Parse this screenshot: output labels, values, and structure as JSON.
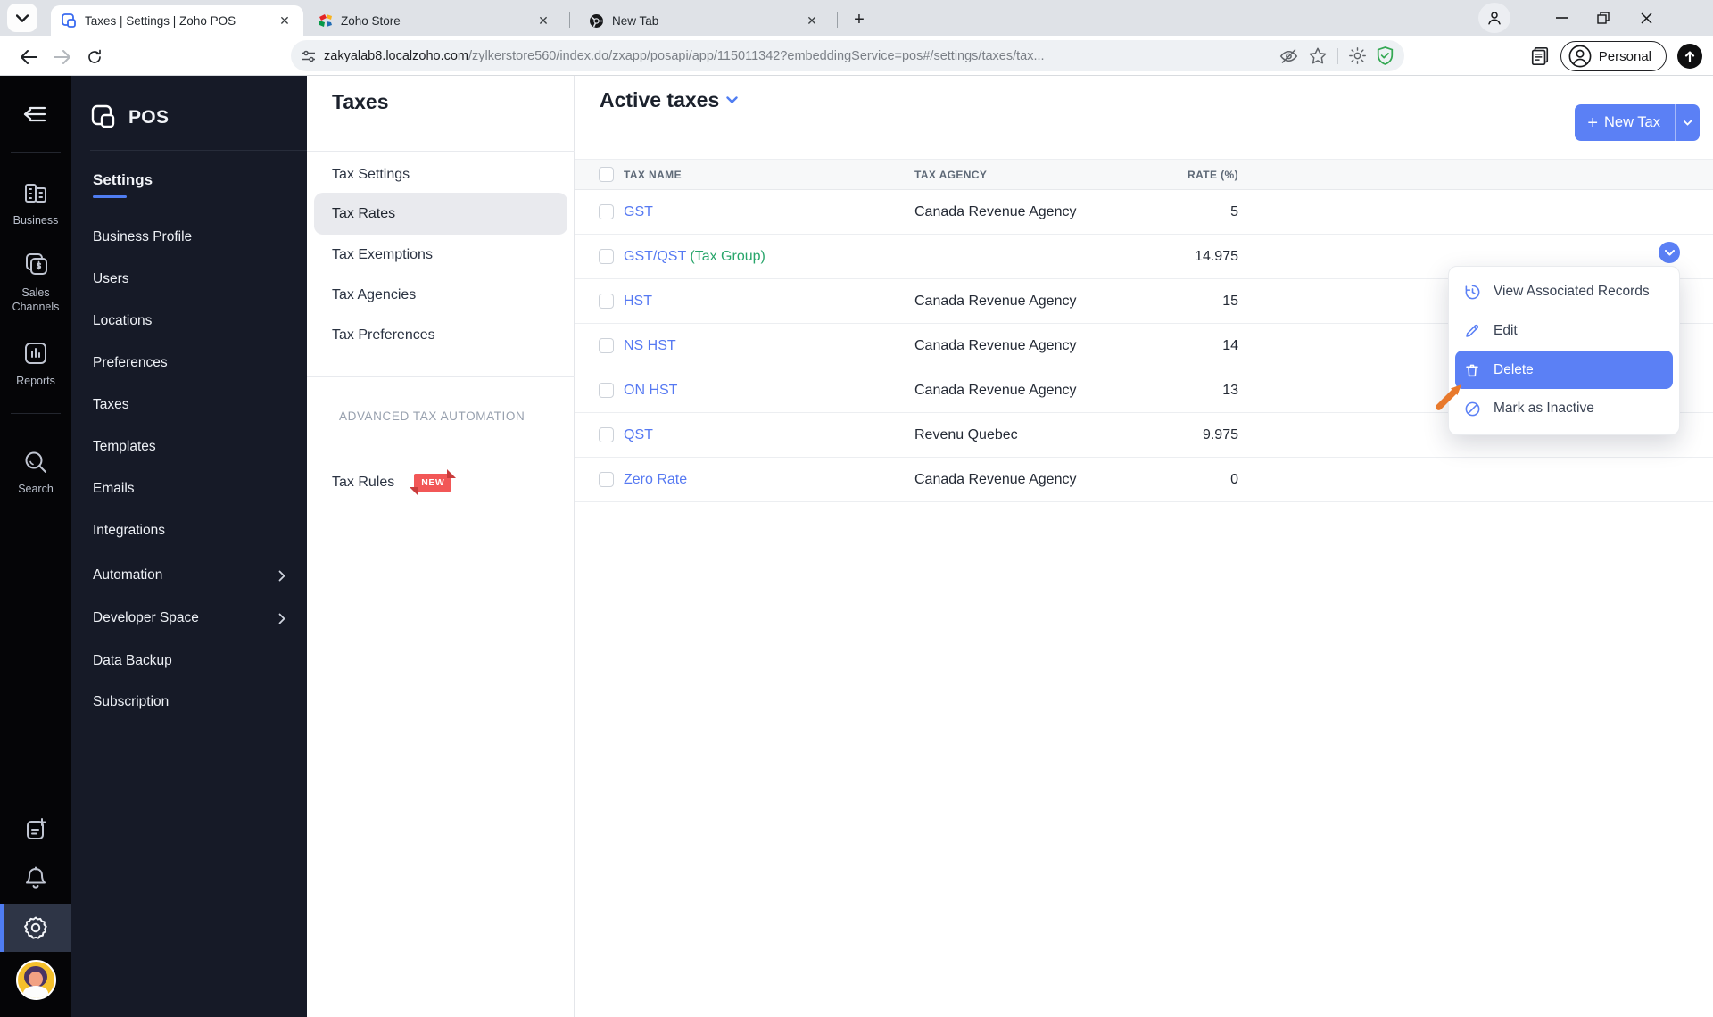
{
  "browser": {
    "tab_search_icon": "chevron-down",
    "tabs": [
      {
        "title": "Taxes | Settings | Zoho POS",
        "close": "✕"
      },
      {
        "title": "Zoho Store",
        "close": "✕"
      },
      {
        "title": "New Tab",
        "close": "✕"
      }
    ],
    "new_tab_button": "+",
    "url_host": "zakyalab8.localzoho.com",
    "url_path": "/zylkerstore560/index.do/zxapp/posapi/app/115011342?embeddingService=pos#/settings/taxes/tax...",
    "profile_label": "Personal",
    "window_minimize": "–",
    "window_close": "✕"
  },
  "rail": {
    "items": [
      {
        "label": "Business"
      },
      {
        "label": "Sales Channels"
      },
      {
        "label": "Reports"
      },
      {
        "label": "Search"
      }
    ]
  },
  "nav": {
    "brand": "POS",
    "section": "Settings",
    "items": [
      "Business Profile",
      "Users",
      "Locations",
      "Preferences",
      "Taxes",
      "Templates",
      "Emails",
      "Integrations",
      "Automation",
      "Developer Space",
      "Data Backup",
      "Subscription"
    ]
  },
  "taxes_panel": {
    "title": "Taxes",
    "items": [
      "Tax Settings",
      "Tax Rates",
      "Tax Exemptions",
      "Tax Agencies",
      "Tax Preferences"
    ],
    "selected": "Tax Rates",
    "advanced_section": "ADVANCED TAX AUTOMATION",
    "advanced_item": "Tax Rules",
    "badge": "NEW"
  },
  "main": {
    "view_label": "Active taxes",
    "new_tax_label": "New Tax",
    "new_tax_plus": "+",
    "table": {
      "columns": [
        "TAX NAME",
        "TAX AGENCY",
        "RATE (%)"
      ],
      "rows": [
        {
          "name": "GST",
          "suffix": "",
          "agency": "Canada Revenue Agency",
          "rate": "5"
        },
        {
          "name": "GST/QST",
          "suffix": " (Tax Group)",
          "agency": "",
          "rate": "14.975"
        },
        {
          "name": "HST",
          "suffix": "",
          "agency": "Canada Revenue Agency",
          "rate": "15"
        },
        {
          "name": "NS HST",
          "suffix": "",
          "agency": "Canada Revenue Agency",
          "rate": "14"
        },
        {
          "name": "ON HST",
          "suffix": "",
          "agency": "Canada Revenue Agency",
          "rate": "13"
        },
        {
          "name": "QST",
          "suffix": "",
          "agency": "Revenu Quebec",
          "rate": "9.975"
        },
        {
          "name": "Zero Rate",
          "suffix": "",
          "agency": "Canada Revenue Agency",
          "rate": "0"
        }
      ]
    },
    "menu": {
      "items": [
        "View Associated Records",
        "Edit",
        "Delete",
        "Mark as Inactive"
      ],
      "highlighted": "Delete"
    }
  },
  "colors": {
    "accent_blue": "#5b80f5",
    "link_blue": "#5679f2",
    "group_green": "#27a56a",
    "badge_red": "#f25757",
    "arrow_orange": "#e8792c"
  }
}
